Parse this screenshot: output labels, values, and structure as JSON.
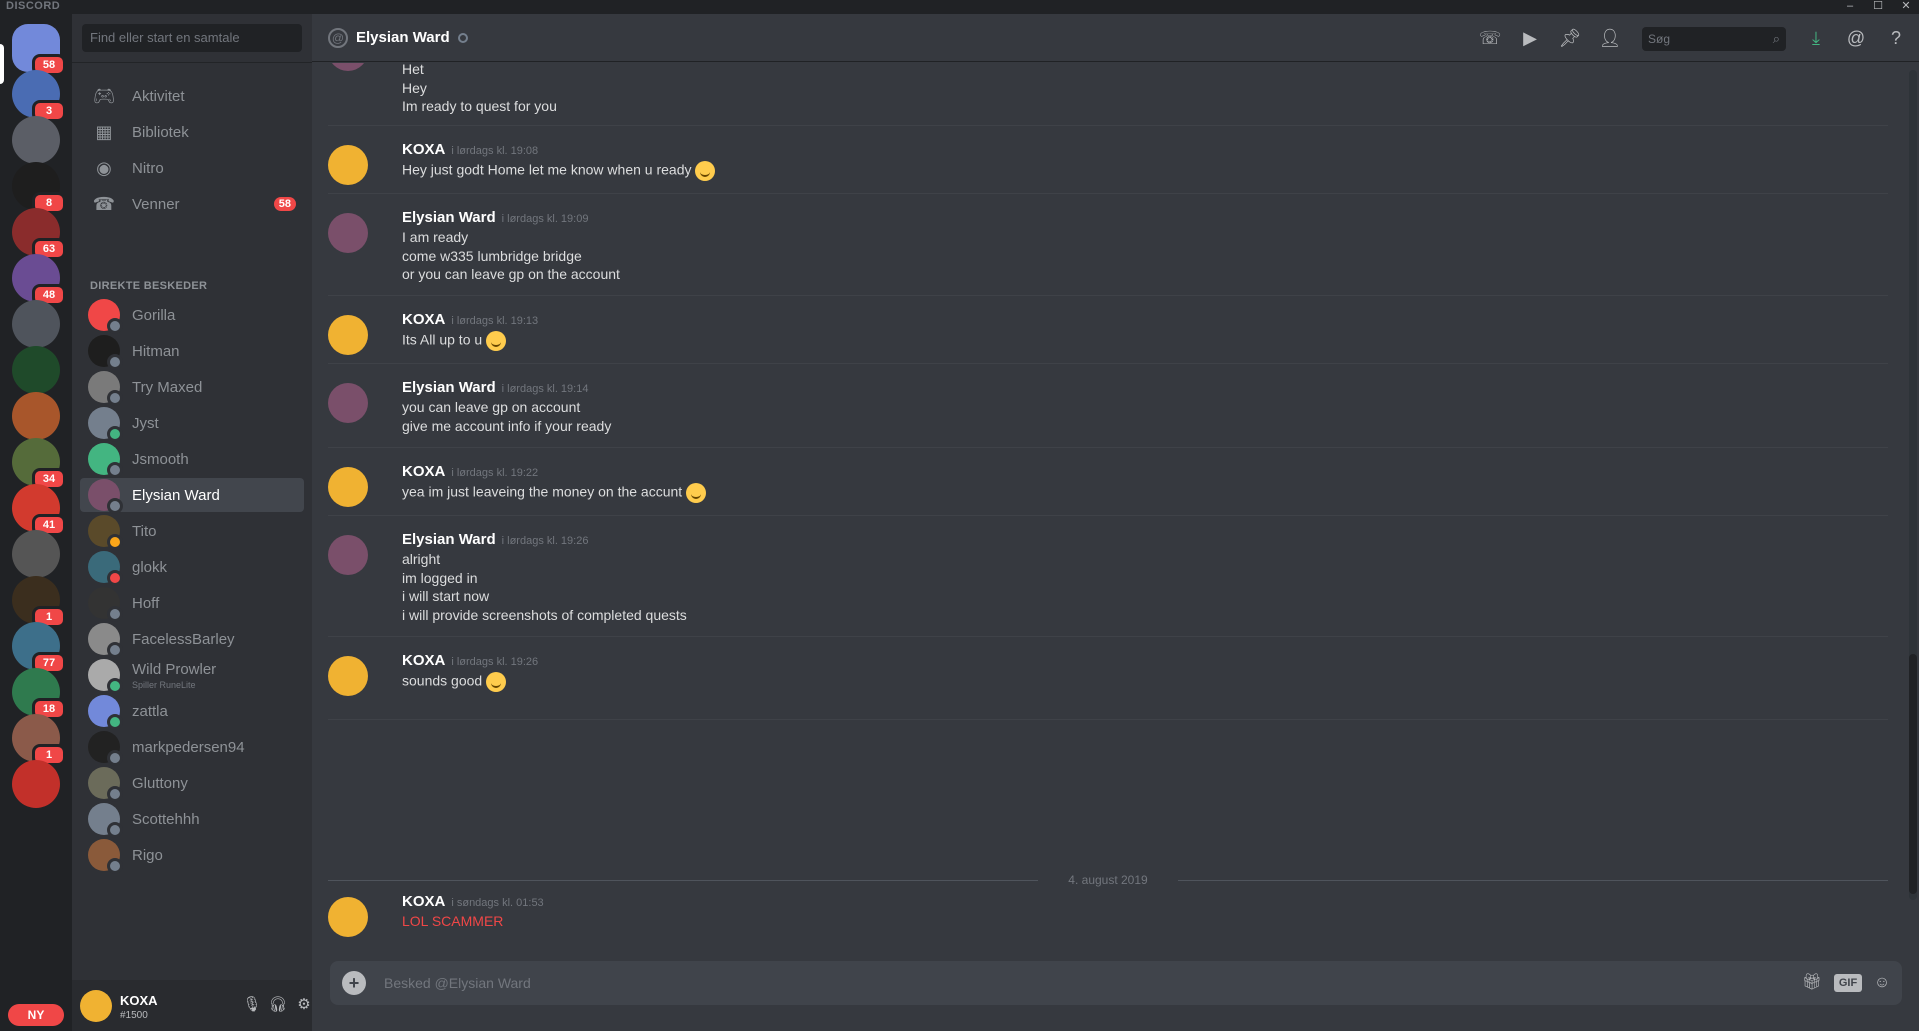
{
  "titlebar": {
    "brand": "DISCORD",
    "minimize": "–",
    "maximize": "☐",
    "close": "✕"
  },
  "guilds": [
    {
      "color": "#7289da",
      "badge": "58",
      "selected": true
    },
    {
      "color": "#4a6cb3",
      "badge": "3"
    },
    {
      "color": "#5b5e66",
      "badge": ""
    },
    {
      "color": "#1e1e1e",
      "badge": "8"
    },
    {
      "color": "#8a2c2c",
      "badge": "63"
    },
    {
      "color": "#6a4c93",
      "badge": "48"
    },
    {
      "color": "#4f545c",
      "badge": ""
    },
    {
      "color": "#1f4a2a",
      "badge": ""
    },
    {
      "color": "#a8562b",
      "badge": ""
    },
    {
      "color": "#556b3a",
      "badge": "34"
    },
    {
      "color": "#d23a2e",
      "badge": "41"
    },
    {
      "color": "#555555",
      "badge": ""
    },
    {
      "color": "#3b2e1e",
      "badge": "1"
    },
    {
      "color": "#3d6f8a",
      "badge": "77"
    },
    {
      "color": "#2f7a4e",
      "badge": "18"
    },
    {
      "color": "#8b5a4a",
      "badge": "1"
    },
    {
      "color": "#c2302a",
      "badge": ""
    }
  ],
  "guild_new_label": "NY",
  "dm": {
    "search_placeholder": "Find eller start en samtale",
    "nav": [
      {
        "label": "Aktivitet",
        "icon": "controller-icon",
        "glyph": "🎮︎"
      },
      {
        "label": "Bibliotek",
        "icon": "library-icon",
        "glyph": "▦"
      },
      {
        "label": "Nitro",
        "icon": "nitro-icon",
        "glyph": "◉"
      },
      {
        "label": "Venner",
        "icon": "friends-icon",
        "glyph": "☎",
        "badge": "58"
      }
    ],
    "header": "DIREKTE BESKEDER",
    "items": [
      {
        "name": "Gorilla",
        "color": "#f04747",
        "status": "#747f8d"
      },
      {
        "name": "Hitman",
        "color": "#1e1e1e",
        "status": "#747f8d"
      },
      {
        "name": "Try Maxed",
        "color": "#7a7a7a",
        "status": "#747f8d"
      },
      {
        "name": "Jyst",
        "color": "#747f8d",
        "status": "#43b581"
      },
      {
        "name": "Jsmooth",
        "color": "#43b581",
        "status": "#747f8d"
      },
      {
        "name": "Elysian Ward",
        "color": "#7a4f6a",
        "status": "#747f8d",
        "active": true
      },
      {
        "name": "Tito",
        "color": "#5a4a2a",
        "status": "#faa61a"
      },
      {
        "name": "glokk",
        "color": "#3a6a7a",
        "status": "#f04747"
      },
      {
        "name": "Hoff",
        "color": "#333333",
        "status": "#747f8d"
      },
      {
        "name": "FacelessBarley",
        "color": "#8a8a8a",
        "status": "#747f8d"
      },
      {
        "name": "Wild Prowler",
        "color": "#aaaaaa",
        "status": "#43b581",
        "sub": "Spiller RuneLite"
      },
      {
        "name": "zattla",
        "color": "#7289da",
        "status": "#43b581"
      },
      {
        "name": "markpedersen94",
        "color": "#222222",
        "status": "#747f8d"
      },
      {
        "name": "Gluttony",
        "color": "#6b6b5a",
        "status": "#747f8d"
      },
      {
        "name": "Scottehhh",
        "color": "#747f8d",
        "status": "#747f8d"
      },
      {
        "name": "Rigo",
        "color": "#8a5a3a",
        "status": "#747f8d"
      }
    ]
  },
  "user": {
    "name": "KOXA",
    "tag": "#1500",
    "mic": "🎙︎",
    "headset": "🎧︎",
    "settings": "⚙"
  },
  "chat": {
    "title": "Elysian Ward",
    "search_placeholder": "Søg",
    "composer_placeholder": "Besked @Elysian Ward",
    "date_separator": "4. august 2019",
    "colors": {
      "koxa": "#f0b232",
      "elysian": "#7a4f6a"
    },
    "messages": [
      {
        "author": "",
        "ts": "",
        "who": "elysian",
        "lines": [
          "Het",
          "Hey",
          "Im ready to quest for you"
        ],
        "headless": true
      },
      {
        "author": "KOXA",
        "ts": "i lørdags kl. 19:08",
        "who": "koxa",
        "lines": [
          "Hey just godt Home let me know when u ready"
        ],
        "emoji": [
          0
        ]
      },
      {
        "author": "Elysian Ward",
        "ts": "i lørdags kl. 19:09",
        "who": "elysian",
        "lines": [
          "I am ready",
          "come w335 lumbridge bridge",
          "or you can leave gp on the account"
        ]
      },
      {
        "author": "KOXA",
        "ts": "i lørdags kl. 19:13",
        "who": "koxa",
        "lines": [
          "Its All up to u"
        ],
        "emoji": [
          0
        ]
      },
      {
        "author": "Elysian Ward",
        "ts": "i lørdags kl. 19:14",
        "who": "elysian",
        "lines": [
          "you can leave gp on account",
          "give me account info if your ready"
        ]
      },
      {
        "author": "KOXA",
        "ts": "i lørdags kl. 19:22",
        "who": "koxa",
        "lines": [
          "yea im just leaveing the money on the accunt"
        ],
        "emoji": [
          0
        ]
      },
      {
        "author": "Elysian Ward",
        "ts": "i lørdags kl. 19:26",
        "who": "elysian",
        "lines": [
          "alright",
          "im logged in",
          "i will start now",
          "i will provide screenshots of completed quests"
        ]
      },
      {
        "author": "KOXA",
        "ts": "i lørdags kl. 19:26",
        "who": "koxa",
        "lines": [
          "sounds good"
        ],
        "emoji": [
          0
        ]
      },
      {
        "author": "KOXA",
        "ts": "i søndags kl. 01:53",
        "who": "koxa",
        "lines": [
          "LOL SCAMMER"
        ],
        "red": true
      }
    ]
  }
}
